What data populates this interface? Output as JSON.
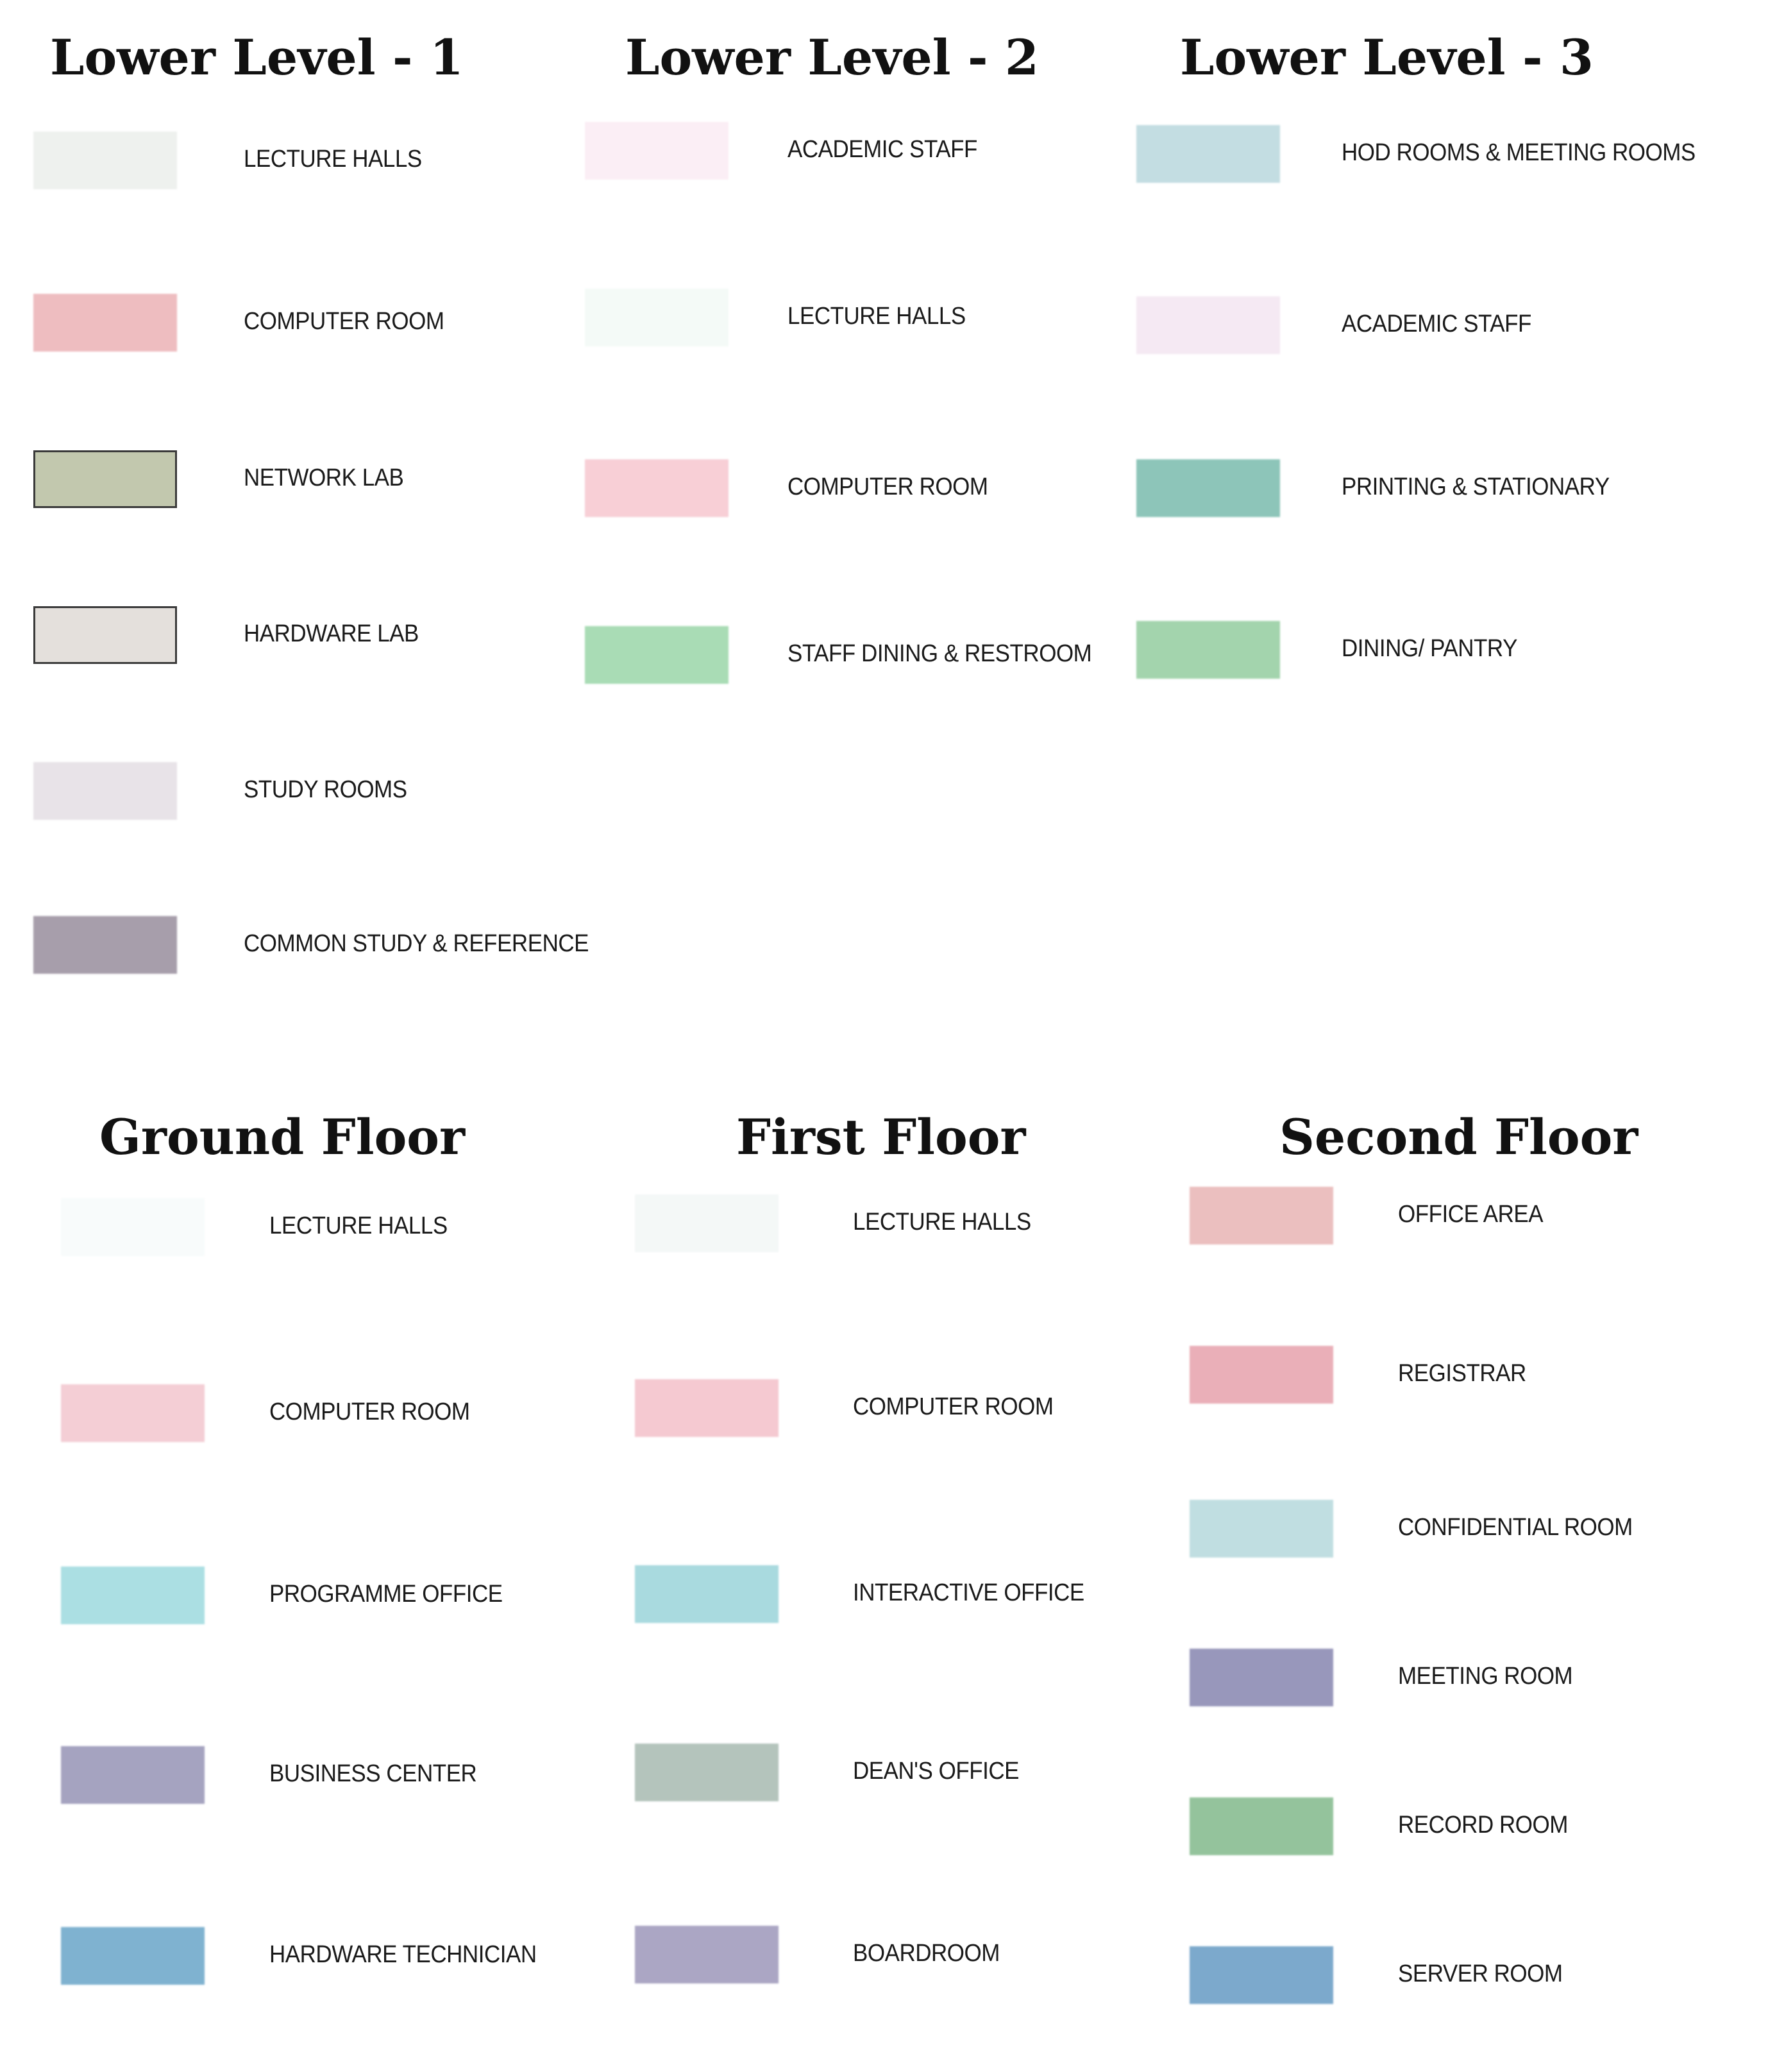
{
  "sections": [
    {
      "id": "lower-level-1",
      "title": "Lower Level - 1",
      "items": [
        {
          "label": "LECTURE HALLS",
          "color": "#eef1ee",
          "bordered": false
        },
        {
          "label": "COMPUTER ROOM",
          "color": "#eebdc0",
          "bordered": false
        },
        {
          "label": "NETWORK LAB",
          "color": "#c2c8ae",
          "bordered": true
        },
        {
          "label": "HARDWARE LAB",
          "color": "#e4e0dc",
          "bordered": true
        },
        {
          "label": "STUDY ROOMS",
          "color": "#e8e3e8",
          "bordered": false
        },
        {
          "label": "COMMON STUDY & REFERENCE",
          "color": "#a79eab",
          "bordered": false
        }
      ]
    },
    {
      "id": "lower-level-2",
      "title": "Lower Level - 2",
      "items": [
        {
          "label": "ACADEMIC STAFF",
          "color": "#fbeef5",
          "bordered": false
        },
        {
          "label": "LECTURE HALLS",
          "color": "#f4faf7",
          "bordered": false
        },
        {
          "label": "COMPUTER ROOM",
          "color": "#f8cfd6",
          "bordered": false
        },
        {
          "label": "STAFF DINING & RESTROOM",
          "color": "#a9dcb5",
          "bordered": false
        }
      ]
    },
    {
      "id": "lower-level-3",
      "title": "Lower Level - 3",
      "items": [
        {
          "label": "HOD ROOMS & MEETING ROOMS",
          "color": "#c3dde2",
          "bordered": false
        },
        {
          "label": "ACADEMIC STAFF",
          "color": "#f5e9f3",
          "bordered": false
        },
        {
          "label": "PRINTING & STATIONARY",
          "color": "#8dc5b9",
          "bordered": false
        },
        {
          "label": "DINING/ PANTRY",
          "color": "#a3d4ad",
          "bordered": false
        }
      ]
    },
    {
      "id": "ground-floor",
      "title": "Ground Floor",
      "items": [
        {
          "label": "LECTURE HALLS",
          "color": "#f8fbfb",
          "bordered": false
        },
        {
          "label": "COMPUTER ROOM",
          "color": "#f4ced5",
          "bordered": false
        },
        {
          "label": "PROGRAMME OFFICE",
          "color": "#abdfe3",
          "bordered": false
        },
        {
          "label": "BUSINESS CENTER",
          "color": "#a5a3c0",
          "bordered": false
        },
        {
          "label": "HARDWARE TECHNICIAN",
          "color": "#7fb2d0",
          "bordered": false
        }
      ]
    },
    {
      "id": "first-floor",
      "title": "First Floor",
      "items": [
        {
          "label": "LECTURE HALLS",
          "color": "#f4f8f7",
          "bordered": false
        },
        {
          "label": "COMPUTER ROOM",
          "color": "#f5c9d1",
          "bordered": false
        },
        {
          "label": "INTERACTIVE OFFICE",
          "color": "#a9dadf",
          "bordered": false
        },
        {
          "label": "DEAN'S OFFICE",
          "color": "#b4c4bc",
          "bordered": false
        },
        {
          "label": "BOARDROOM",
          "color": "#aba6c4",
          "bordered": false
        }
      ]
    },
    {
      "id": "second-floor",
      "title": "Second Floor",
      "items": [
        {
          "label": "OFFICE AREA",
          "color": "#ebbfbf",
          "bordered": false
        },
        {
          "label": "REGISTRAR",
          "color": "#eaafb8",
          "bordered": false
        },
        {
          "label": "CONFIDENTIAL ROOM",
          "color": "#c0dee1",
          "bordered": false
        },
        {
          "label": "MEETING ROOM",
          "color": "#9897bb",
          "bordered": false
        },
        {
          "label": "RECORD ROOM",
          "color": "#94c39c",
          "bordered": false
        },
        {
          "label": "SERVER ROOM",
          "color": "#7ca9cc",
          "bordered": false
        }
      ]
    }
  ]
}
